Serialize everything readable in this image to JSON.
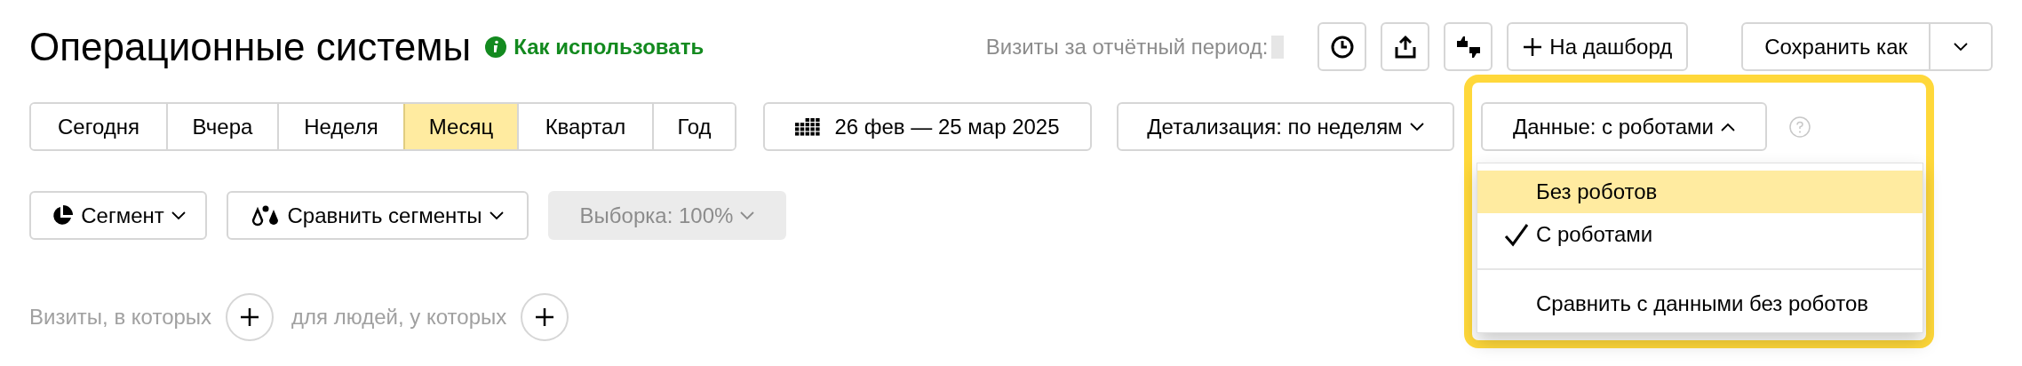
{
  "header": {
    "title": "Операционные системы",
    "help_link": "Как использовать",
    "visits_label": "Визиты за отчётный период:",
    "add_to_dashboard": "На дашборд",
    "save_as": "Сохранить как"
  },
  "periods": [
    {
      "label": "Сегодня",
      "selected": false
    },
    {
      "label": "Вчера",
      "selected": false
    },
    {
      "label": "Неделя",
      "selected": false
    },
    {
      "label": "Месяц",
      "selected": true
    },
    {
      "label": "Квартал",
      "selected": false
    },
    {
      "label": "Год",
      "selected": false
    }
  ],
  "date_range": "26 фев — 25 мар 2025",
  "detail_dropdown": "Детализация: по неделям",
  "data_dropdown": {
    "label": "Данные: с роботами",
    "expanded": true,
    "highlighted_frame": true,
    "items": [
      {
        "label": "Без роботов",
        "checked": false,
        "highlighted": true
      },
      {
        "label": "С роботами",
        "checked": true,
        "highlighted": false
      },
      {
        "label": "Сравнить с данными без роботов",
        "checked": false,
        "highlighted": false
      }
    ]
  },
  "segment_buttons": [
    {
      "label": "Сегмент",
      "kind": "segment",
      "disabled": false
    },
    {
      "label": "Сравнить сегменты",
      "kind": "compare",
      "disabled": false
    },
    {
      "label": "Выборка: 100%",
      "kind": "sample",
      "disabled": true
    }
  ],
  "conditions": [
    "Визиты, в которых",
    "для людей, у которых"
  ]
}
